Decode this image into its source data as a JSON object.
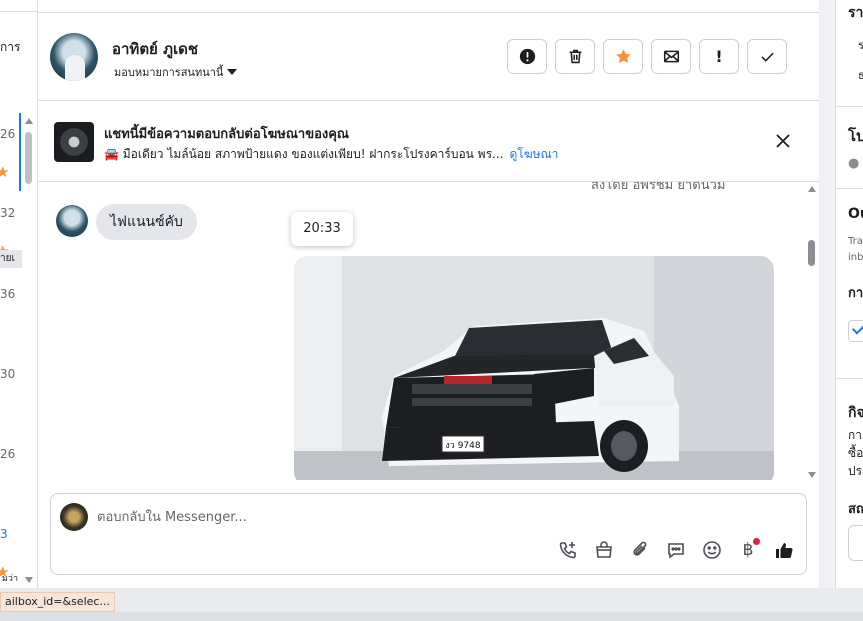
{
  "left_list": {
    "header_fragment": "การ",
    "times": [
      "26",
      "32",
      "36",
      "30",
      "26",
      "3"
    ],
    "chip_fragment": "ายเ",
    "bottom_fragment": "มว่า"
  },
  "conversation": {
    "name": "อาทิตย์ ภูเดช",
    "assign_label": "มอบหมายการสนทนานี้",
    "actions": [
      {
        "name": "mark-spam-button",
        "icon": "exclamation-circle-icon"
      },
      {
        "name": "delete-button",
        "icon": "trash-icon"
      },
      {
        "name": "star-button",
        "icon": "star-icon"
      },
      {
        "name": "mark-unread-button",
        "icon": "envelope-icon"
      },
      {
        "name": "follow-up-button",
        "label": "!"
      },
      {
        "name": "mark-done-button",
        "icon": "check-icon"
      }
    ]
  },
  "ad_banner": {
    "title": "แชทนี้มีข้อความตอบกลับต่อโฆษณาของคุณ",
    "subtitle": "🚘 มือเดียว ไมล์น้อย สภาพป้ายแดง ของแต่งเพียบ! ฝากระโปรงคาร์บอน พร...",
    "link": "ดูโฆษณา"
  },
  "messages": {
    "cut_off_text": "ส่งโดย อพิรัชม์ ยำดีน่วม",
    "incoming_text": "ไฟแนนซ์คับ",
    "timestamp_tooltip": "20:33",
    "plate_text": "งว 9748"
  },
  "composer": {
    "placeholder": "ตอบกลับใน Messenger...",
    "tools": [
      "call-icon",
      "shopping-bag-icon",
      "attachment-icon",
      "saved-reply-icon",
      "emoji-icon",
      "baht-payment-icon",
      "thumbs-up-icon"
    ],
    "baht_symbol": "฿"
  },
  "right_panel": {
    "frag1": "รา",
    "frag2": "ร",
    "frag3": "ธ",
    "frag4": "โป",
    "frag5": "Ou",
    "frag6": "Tra",
    "frag7": "inb",
    "frag8": "กา",
    "frag9": "กิจ",
    "frag10": "กา",
    "frag11": "ซื้อ",
    "frag12": "ประ",
    "frag13": "สถ"
  },
  "status_bar": {
    "url_fragment": "ailbox_id=&selec..."
  },
  "colors": {
    "accent": "#1877f2",
    "star": "#f7923a",
    "notification_dot": "#e41e3f"
  }
}
